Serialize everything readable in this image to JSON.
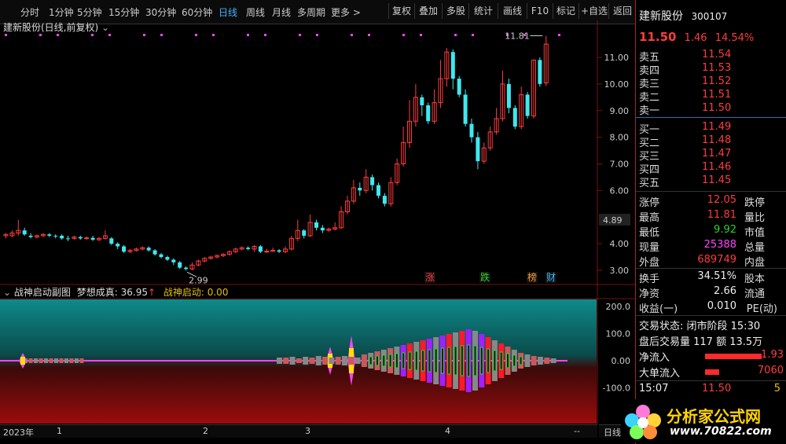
{
  "toolbar": {
    "periods": [
      "分时",
      "1分钟",
      "5分钟",
      "15分钟",
      "30分钟",
      "60分钟",
      "日线",
      "周线",
      "月线",
      "多周期",
      "更多 >"
    ],
    "active": "日线",
    "tools": [
      "复权",
      "叠加",
      "多股",
      "统计",
      "画线",
      "F10",
      "标记",
      "+自选",
      "返回"
    ]
  },
  "main_chart": {
    "title": "建新股份(日线,前复权)",
    "y_axis_ticks": [
      "11.00",
      "10.00",
      "9.00",
      "8.00",
      "7.00",
      "6.00",
      "4.89",
      "4.00",
      "3.00"
    ],
    "high_label": "11.81",
    "low_label": "2.99",
    "markers": [
      "涨",
      "跌",
      "榜",
      "财"
    ]
  },
  "sub_chart": {
    "title": "战神启动副图",
    "line1_label": "梦想成真:",
    "line1_value": "36.95",
    "line2_label": "战神启动:",
    "line2_value": "0.00",
    "y_ticks": [
      "200.0",
      "100.0",
      "0.00",
      "-100.0"
    ]
  },
  "x_axis": {
    "labels": [
      "2023年",
      "1",
      "2",
      "3",
      "4",
      "--"
    ],
    "period_label": "日线"
  },
  "quote": {
    "name": "建新股份",
    "code": "300107",
    "price": "11.50",
    "change": "1.46",
    "change_pct": "14.54%",
    "asks": [
      {
        "label": "卖五",
        "price": "11.54"
      },
      {
        "label": "卖四",
        "price": "11.53"
      },
      {
        "label": "卖三",
        "price": "11.52"
      },
      {
        "label": "卖二",
        "price": "11.51"
      },
      {
        "label": "卖一",
        "price": "11.50"
      }
    ],
    "bids": [
      {
        "label": "买一",
        "price": "11.49"
      },
      {
        "label": "买二",
        "price": "11.48"
      },
      {
        "label": "买三",
        "price": "11.47"
      },
      {
        "label": "买四",
        "price": "11.46"
      },
      {
        "label": "买五",
        "price": "11.45"
      }
    ],
    "stats": [
      {
        "label": "涨停",
        "value": "12.05",
        "label2": "跌停"
      },
      {
        "label": "最高",
        "value": "11.81",
        "label2": "量比"
      },
      {
        "label": "最低",
        "value": "9.92",
        "label2": "市值"
      },
      {
        "label": "现量",
        "value": "25388",
        "label2": "总量"
      },
      {
        "label": "外盘",
        "value": "689749",
        "label2": "内盘"
      }
    ],
    "turnover_label": "换手",
    "turnover": "34.51%",
    "turnover_label2": "股本",
    "netasset_label": "净资",
    "netasset": "2.66",
    "netasset_label2": "流通",
    "eps_label": "收益(一)",
    "eps": "0.010",
    "eps_label2": "PE(动)",
    "trade_status": "交易状态: 闭市阶段 15:30",
    "after_hours": "盘后交易量 117 额 13.5万",
    "net_inflow_label": "净流入",
    "net_inflow": "1.93",
    "big_order_label": "大单流入",
    "big_order": "7060",
    "last_time": "15:07",
    "last_price": "11.50",
    "last_vol": "5"
  },
  "logo": {
    "text": "分析家公式网",
    "url": "www.70822.com"
  }
}
